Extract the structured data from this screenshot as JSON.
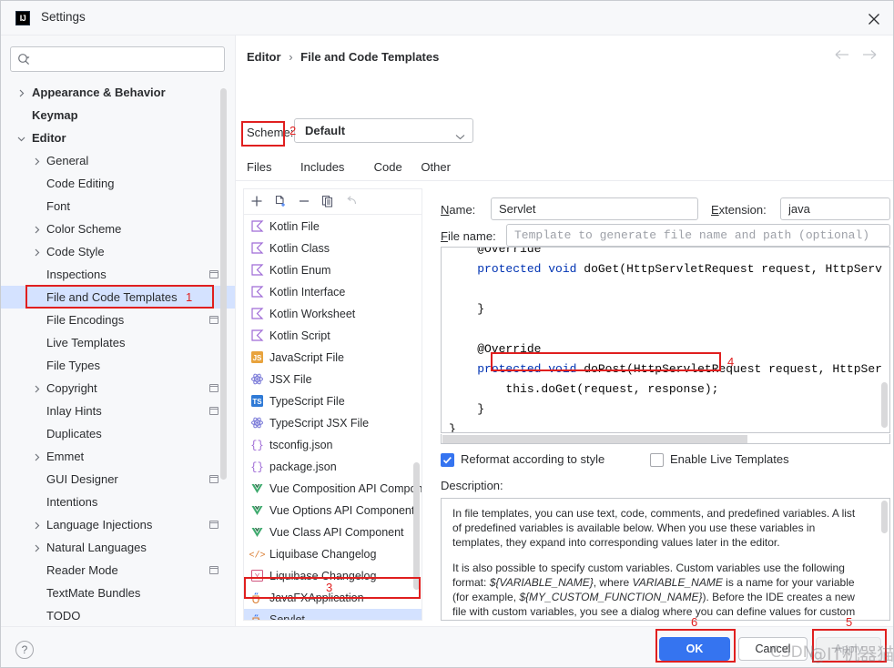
{
  "window": {
    "title": "Settings",
    "app_icon_text": "IJ",
    "close_icon": "close-icon"
  },
  "sidebar": {
    "search": {
      "value": "",
      "placeholder": ""
    },
    "items": [
      {
        "label": "Appearance & Behavior",
        "indent": 0,
        "arrow": "right",
        "bold": true,
        "modified": false,
        "selected": false
      },
      {
        "label": "Keymap",
        "indent": 0,
        "arrow": "none",
        "bold": true,
        "modified": false,
        "selected": false
      },
      {
        "label": "Editor",
        "indent": 0,
        "arrow": "down",
        "bold": true,
        "modified": false,
        "selected": false
      },
      {
        "label": "General",
        "indent": 1,
        "arrow": "right",
        "bold": false,
        "modified": false,
        "selected": false
      },
      {
        "label": "Code Editing",
        "indent": 1,
        "arrow": "none",
        "bold": false,
        "modified": false,
        "selected": false
      },
      {
        "label": "Font",
        "indent": 1,
        "arrow": "none",
        "bold": false,
        "modified": false,
        "selected": false
      },
      {
        "label": "Color Scheme",
        "indent": 1,
        "arrow": "right",
        "bold": false,
        "modified": false,
        "selected": false
      },
      {
        "label": "Code Style",
        "indent": 1,
        "arrow": "right",
        "bold": false,
        "modified": false,
        "selected": false
      },
      {
        "label": "Inspections",
        "indent": 1,
        "arrow": "none",
        "bold": false,
        "modified": true,
        "selected": false
      },
      {
        "label": "File and Code Templates",
        "indent": 1,
        "arrow": "none",
        "bold": false,
        "modified": false,
        "selected": true
      },
      {
        "label": "File Encodings",
        "indent": 1,
        "arrow": "none",
        "bold": false,
        "modified": true,
        "selected": false
      },
      {
        "label": "Live Templates",
        "indent": 1,
        "arrow": "none",
        "bold": false,
        "modified": false,
        "selected": false
      },
      {
        "label": "File Types",
        "indent": 1,
        "arrow": "none",
        "bold": false,
        "modified": false,
        "selected": false
      },
      {
        "label": "Copyright",
        "indent": 1,
        "arrow": "right",
        "bold": false,
        "modified": true,
        "selected": false
      },
      {
        "label": "Inlay Hints",
        "indent": 1,
        "arrow": "none",
        "bold": false,
        "modified": true,
        "selected": false
      },
      {
        "label": "Duplicates",
        "indent": 1,
        "arrow": "none",
        "bold": false,
        "modified": false,
        "selected": false
      },
      {
        "label": "Emmet",
        "indent": 1,
        "arrow": "right",
        "bold": false,
        "modified": false,
        "selected": false
      },
      {
        "label": "GUI Designer",
        "indent": 1,
        "arrow": "none",
        "bold": false,
        "modified": true,
        "selected": false
      },
      {
        "label": "Intentions",
        "indent": 1,
        "arrow": "none",
        "bold": false,
        "modified": false,
        "selected": false
      },
      {
        "label": "Language Injections",
        "indent": 1,
        "arrow": "right",
        "bold": false,
        "modified": true,
        "selected": false
      },
      {
        "label": "Natural Languages",
        "indent": 1,
        "arrow": "right",
        "bold": false,
        "modified": false,
        "selected": false
      },
      {
        "label": "Reader Mode",
        "indent": 1,
        "arrow": "none",
        "bold": false,
        "modified": true,
        "selected": false
      },
      {
        "label": "TextMate Bundles",
        "indent": 1,
        "arrow": "none",
        "bold": false,
        "modified": false,
        "selected": false
      },
      {
        "label": "TODO",
        "indent": 1,
        "arrow": "none",
        "bold": false,
        "modified": false,
        "selected": false
      }
    ]
  },
  "header": {
    "breadcrumb_parent": "Editor",
    "breadcrumb_sep": "›",
    "breadcrumb_current": "File and Code Templates",
    "back_icon": "arrow-left-icon",
    "forward_icon": "arrow-right-icon"
  },
  "scheme": {
    "label": "Scheme:",
    "value": "Default",
    "chevron_icon": "chevron-down-icon"
  },
  "tabs": [
    {
      "label": "Files",
      "selected": true
    },
    {
      "label": "Includes",
      "selected": false
    },
    {
      "label": "Code",
      "selected": false
    },
    {
      "label": "Other",
      "selected": false
    }
  ],
  "filelist": {
    "toolbar": [
      {
        "name": "add-template-button",
        "icon": "plus-icon"
      },
      {
        "name": "create-child-template-button",
        "icon": "new-file-icon"
      },
      {
        "name": "remove-template-button",
        "icon": "minus-icon"
      },
      {
        "name": "copy-template-button",
        "icon": "copy-icon"
      },
      {
        "name": "reset-template-button",
        "icon": "undo-icon"
      }
    ],
    "items": [
      {
        "label": "Kotlin File",
        "icon": "kotlin-icon",
        "selected": false
      },
      {
        "label": "Kotlin Class",
        "icon": "kotlin-icon",
        "selected": false
      },
      {
        "label": "Kotlin Enum",
        "icon": "kotlin-icon",
        "selected": false
      },
      {
        "label": "Kotlin Interface",
        "icon": "kotlin-icon",
        "selected": false
      },
      {
        "label": "Kotlin Worksheet",
        "icon": "kotlin-icon",
        "selected": false
      },
      {
        "label": "Kotlin Script",
        "icon": "kotlin-icon",
        "selected": false
      },
      {
        "label": "JavaScript File",
        "icon": "javascript-icon",
        "selected": false
      },
      {
        "label": "JSX File",
        "icon": "react-icon",
        "selected": false
      },
      {
        "label": "TypeScript File",
        "icon": "typescript-icon",
        "selected": false
      },
      {
        "label": "TypeScript JSX File",
        "icon": "react-icon",
        "selected": false
      },
      {
        "label": "tsconfig.json",
        "icon": "json-icon",
        "selected": false
      },
      {
        "label": "package.json",
        "icon": "json-icon",
        "selected": false
      },
      {
        "label": "Vue Composition API Component",
        "icon": "vue-icon",
        "selected": false
      },
      {
        "label": "Vue Options API Component",
        "icon": "vue-icon",
        "selected": false
      },
      {
        "label": "Vue Class API Component",
        "icon": "vue-icon",
        "selected": false
      },
      {
        "label": "Liquibase Changelog",
        "icon": "xml-tag-icon",
        "selected": false
      },
      {
        "label": "Liquibase Changelog",
        "icon": "yaml-icon",
        "selected": false
      },
      {
        "label": "JavaFXApplication",
        "icon": "java-icon",
        "selected": false
      },
      {
        "label": "Servlet",
        "icon": "java-icon",
        "selected": true
      }
    ]
  },
  "detail": {
    "name_label": "Name:",
    "name_value": "Servlet",
    "extension_label": "Extension:",
    "extension_value": "java",
    "filename_label": "File name:",
    "filename_value": "",
    "filename_placeholder": "Template to generate file name and path (optional)",
    "code_lines": [
      "@Override",
      "protected void doGet(HttpServletRequest request, HttpServ",
      "",
      "}",
      "",
      "@Override",
      "protected void doPost(HttpServletRequest request, HttpSer",
      "    this.doGet(request, response);",
      "}"
    ],
    "code_closing_brace": "}",
    "reformat_checkbox": {
      "label": "Reformat according to style",
      "checked": true
    },
    "live_templates_checkbox": {
      "label": "Enable Live Templates",
      "checked": false
    },
    "description_label": "Description:",
    "description_paragraphs": [
      "In file templates, you can use text, code, comments, and predefined variables. A list of predefined variables is available below. When you use these variables in templates, they expand into corresponding values later in the editor.",
      "It is also possible to specify custom variables. Custom variables use the following format: ${VARIABLE_NAME}, where VARIABLE_NAME is a name for your variable (for example, ${MY_CUSTOM_FUNCTION_NAME}). Before the IDE creates a new file with custom variables, you see a dialog where you can define values for custom variables in the template."
    ]
  },
  "footer": {
    "help_label": "?",
    "ok_label": "OK",
    "cancel_label": "Cancel",
    "apply_label": "Apply"
  },
  "annotations": [
    {
      "number": "1",
      "target": "sidebar-item-file-and-code-templates"
    },
    {
      "number": "2",
      "target": "tab-files"
    },
    {
      "number": "3",
      "target": "filelist-item-servlet"
    },
    {
      "number": "4",
      "target": "code-line-dogetcall"
    },
    {
      "number": "5",
      "target": "apply-button"
    },
    {
      "number": "6",
      "target": "ok-button"
    }
  ],
  "watermark": {
    "text_left": "CSDN",
    "text_right": "@IT机器猫"
  },
  "colors": {
    "accent": "#3574f0",
    "selection": "#d4e2ff",
    "annotation": "#e01f1f",
    "keyword": "#0033b3",
    "panel_bg": "#f7f8fa"
  }
}
